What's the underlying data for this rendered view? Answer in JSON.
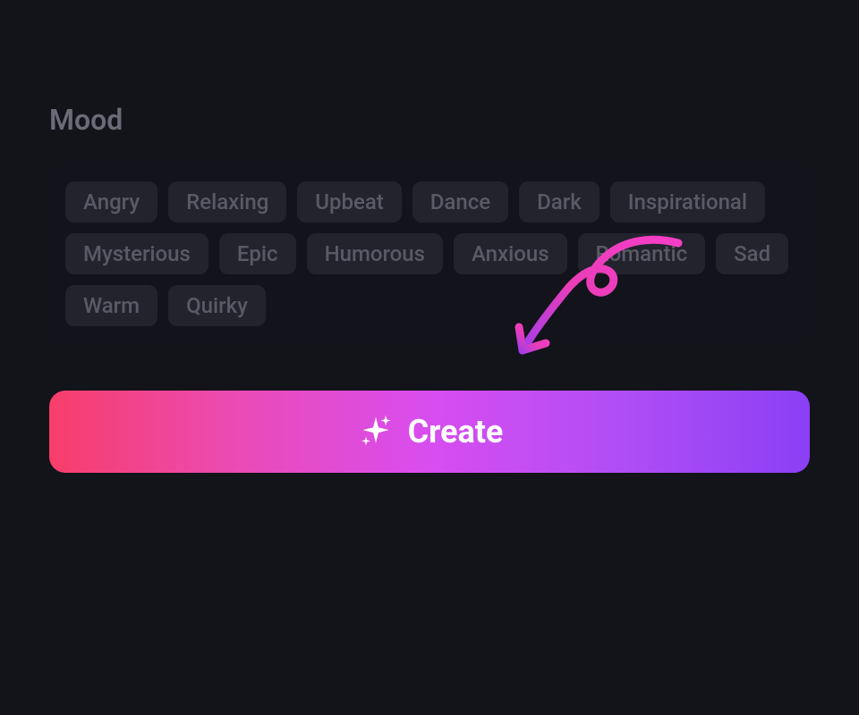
{
  "section": {
    "title": "Mood"
  },
  "tags": [
    "Angry",
    "Relaxing",
    "Upbeat",
    "Dance",
    "Dark",
    "Inspirational",
    "Mysterious",
    "Epic",
    "Humorous",
    "Anxious",
    "Romantic",
    "Sad",
    "Warm",
    "Quirky"
  ],
  "create": {
    "label": "Create"
  }
}
